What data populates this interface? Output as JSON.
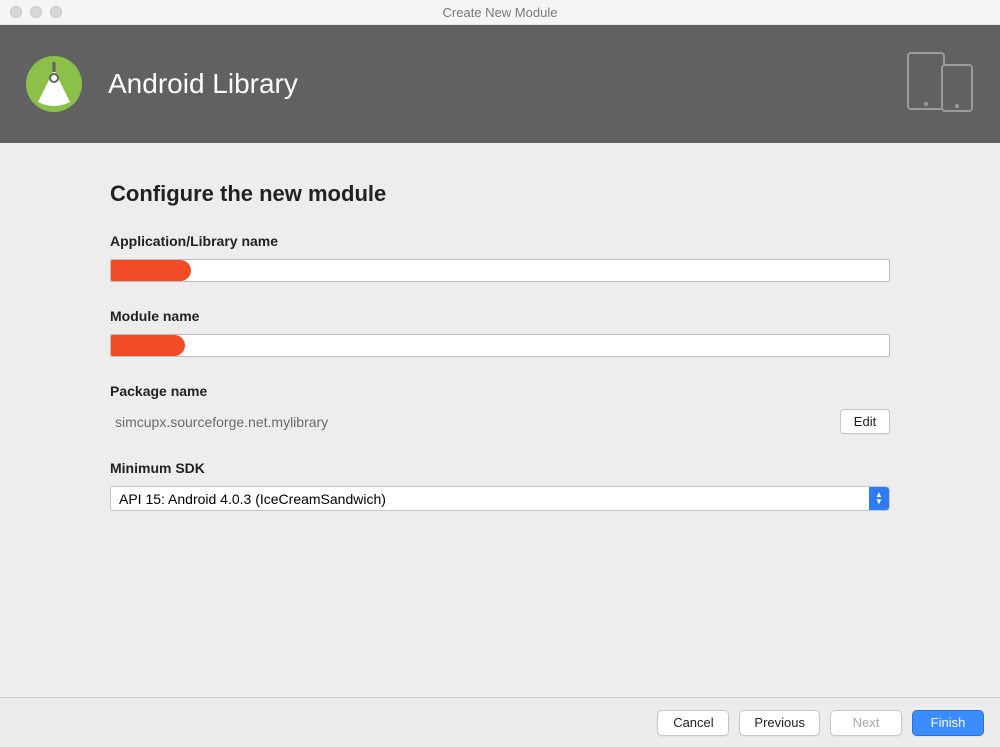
{
  "window": {
    "title": "Create New Module"
  },
  "banner": {
    "title": "Android Library"
  },
  "page": {
    "title": "Configure the new module"
  },
  "fields": {
    "app_name": {
      "label": "Application/Library name",
      "value": ""
    },
    "module_name": {
      "label": "Module name",
      "value": ""
    },
    "package_name": {
      "label": "Package name",
      "value": "simcupx.sourceforge.net.mylibrary",
      "edit_label": "Edit"
    },
    "min_sdk": {
      "label": "Minimum SDK",
      "selected": "API 15: Android 4.0.3 (IceCreamSandwich)"
    }
  },
  "footer": {
    "cancel": "Cancel",
    "previous": "Previous",
    "next": "Next",
    "finish": "Finish"
  }
}
